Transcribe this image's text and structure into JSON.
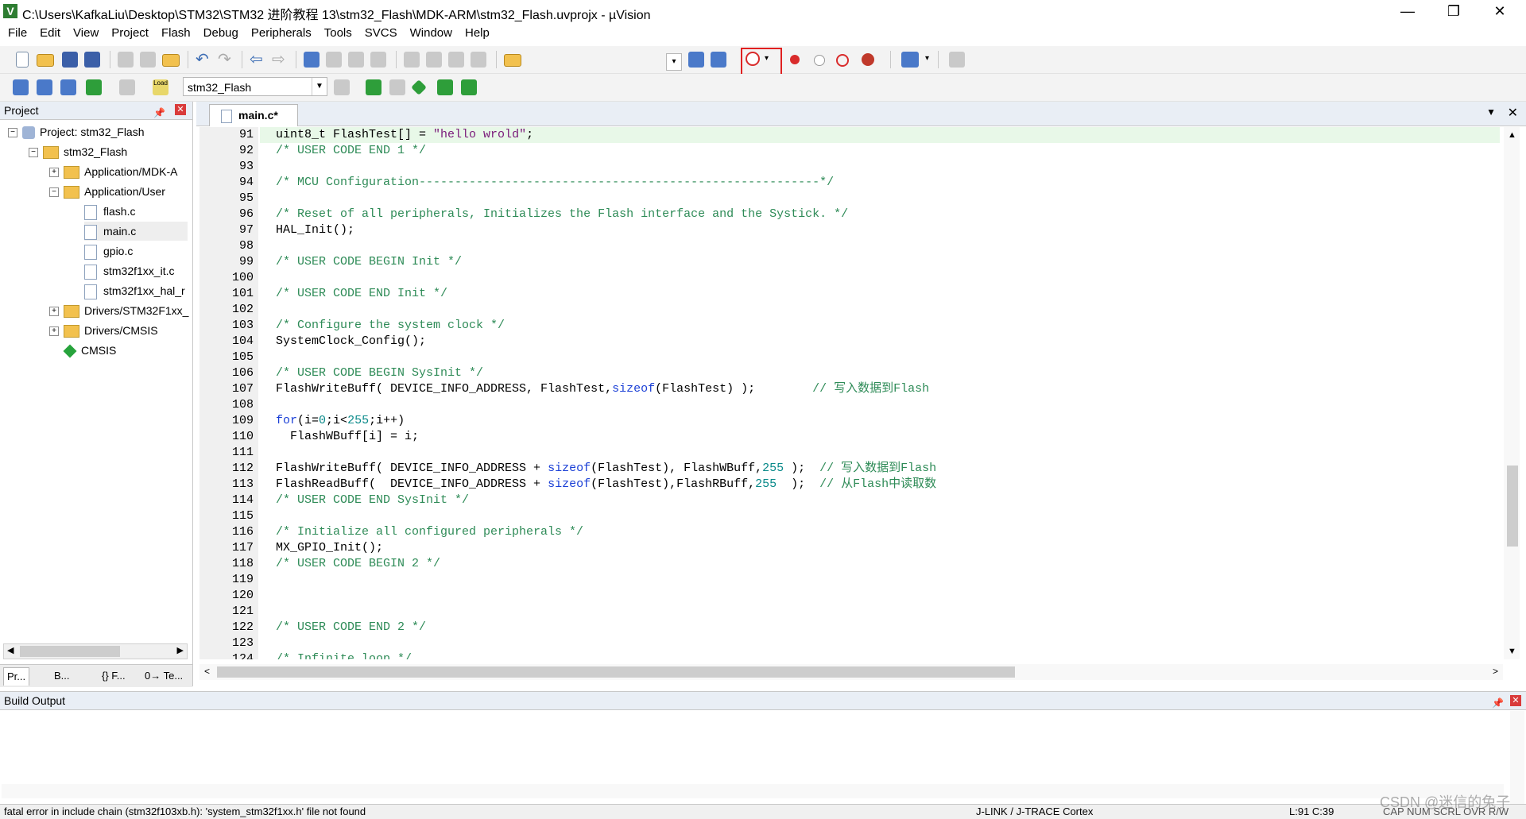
{
  "window": {
    "title": "C:\\Users\\KafkaLiu\\Desktop\\STM32\\STM32 进阶教程 13\\stm32_Flash\\MDK-ARM\\stm32_Flash.uvprojx - µVision",
    "app_icon": "µvision-icon",
    "minimize": "—",
    "maximize": "❐",
    "close": "✕"
  },
  "menu": [
    "File",
    "Edit",
    "View",
    "Project",
    "Flash",
    "Debug",
    "Peripherals",
    "Tools",
    "SVCS",
    "Window",
    "Help"
  ],
  "toolbar2": {
    "target": "stm32_Flash",
    "load_label": "Load"
  },
  "project_panel": {
    "title": "Project",
    "tree": [
      {
        "label": "Project: stm32_Flash",
        "expanded": true
      },
      {
        "label": "stm32_Flash",
        "expanded": true
      },
      {
        "label": "Application/MDK-A",
        "expanded": false
      },
      {
        "label": "Application/User",
        "expanded": true
      },
      {
        "label": "flash.c"
      },
      {
        "label": "main.c",
        "selected": true
      },
      {
        "label": "gpio.c"
      },
      {
        "label": "stm32f1xx_it.c"
      },
      {
        "label": "stm32f1xx_hal_r"
      },
      {
        "label": "Drivers/STM32F1xx_",
        "expanded": false
      },
      {
        "label": "Drivers/CMSIS",
        "expanded": false
      },
      {
        "label": "CMSIS"
      }
    ],
    "tabs": [
      "Pr...",
      "B...",
      "{} F...",
      "0→ Te..."
    ]
  },
  "editor": {
    "tab": "main.c*",
    "lines": [
      {
        "n": "91",
        "t": "uint8_t FlashTest[] = \"hello wrold\";"
      },
      {
        "n": "92",
        "t": "/* USER CODE END 1 */"
      },
      {
        "n": "93",
        "t": ""
      },
      {
        "n": "94",
        "t": "/* MCU Configuration--------------------------------------------------------*/"
      },
      {
        "n": "95",
        "t": ""
      },
      {
        "n": "96",
        "t": "/* Reset of all peripherals, Initializes the Flash interface and the Systick. */"
      },
      {
        "n": "97",
        "t": "HAL_Init();"
      },
      {
        "n": "98",
        "t": ""
      },
      {
        "n": "99",
        "t": "/* USER CODE BEGIN Init */"
      },
      {
        "n": "100",
        "t": ""
      },
      {
        "n": "101",
        "t": "/* USER CODE END Init */"
      },
      {
        "n": "102",
        "t": ""
      },
      {
        "n": "103",
        "t": "/* Configure the system clock */"
      },
      {
        "n": "104",
        "t": "SystemClock_Config();"
      },
      {
        "n": "105",
        "t": ""
      },
      {
        "n": "106",
        "t": "/* USER CODE BEGIN SysInit */"
      },
      {
        "n": "107",
        "t": "FlashWriteBuff( DEVICE_INFO_ADDRESS, FlashTest,sizeof(FlashTest) );        // 写入数据到Flash"
      },
      {
        "n": "108",
        "t": ""
      },
      {
        "n": "109",
        "t": "for(i=0;i<255;i++)"
      },
      {
        "n": "110",
        "t": "  FlashWBuff[i] = i;"
      },
      {
        "n": "111",
        "t": ""
      },
      {
        "n": "112",
        "t": "FlashWriteBuff( DEVICE_INFO_ADDRESS + sizeof(FlashTest), FlashWBuff,255 );  // 写入数据到Flash"
      },
      {
        "n": "113",
        "t": "FlashReadBuff(  DEVICE_INFO_ADDRESS + sizeof(FlashTest),FlashRBuff,255  );  // 从Flash中读取数"
      },
      {
        "n": "114",
        "t": "/* USER CODE END SysInit */"
      },
      {
        "n": "115",
        "t": ""
      },
      {
        "n": "116",
        "t": "/* Initialize all configured peripherals */"
      },
      {
        "n": "117",
        "t": "MX_GPIO_Init();"
      },
      {
        "n": "118",
        "t": "/* USER CODE BEGIN 2 */"
      },
      {
        "n": "119",
        "t": ""
      },
      {
        "n": "120",
        "t": ""
      },
      {
        "n": "121",
        "t": ""
      },
      {
        "n": "122",
        "t": "/* USER CODE END 2 */"
      },
      {
        "n": "123",
        "t": ""
      },
      {
        "n": "124",
        "t": "/* Infinite loop */"
      }
    ]
  },
  "build_output": {
    "title": "Build Output"
  },
  "status": {
    "message": "fatal error in include chain (stm32f103xb.h): 'system_stm32f1xx.h' file not found",
    "debugger": "J-LINK / J-TRACE Cortex",
    "position": "L:91 C:39",
    "flags": "CAP  NUM  SCRL  OVR  R/W"
  },
  "watermark": "CSDN @迷信的兔子"
}
